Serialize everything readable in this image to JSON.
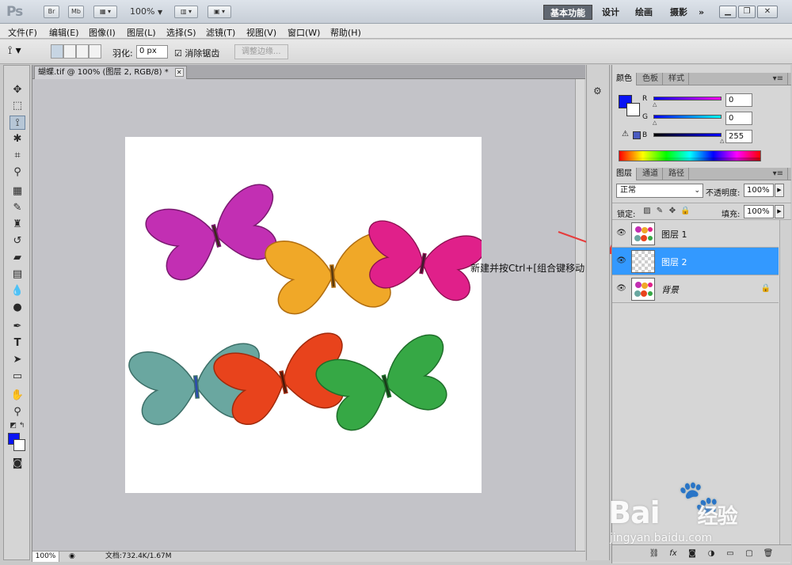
{
  "titlebar": {
    "logo": "Ps",
    "bridge": "Br",
    "minibridge": "Mb",
    "zoom": "100%",
    "workspaces": [
      "基本功能",
      "设计",
      "绘画",
      "摄影"
    ],
    "more": "»"
  },
  "menu": [
    "文件(F)",
    "编辑(E)",
    "图像(I)",
    "图层(L)",
    "选择(S)",
    "滤镜(T)",
    "视图(V)",
    "窗口(W)",
    "帮助(H)"
  ],
  "options": {
    "feather_label": "羽化:",
    "feather_value": "0 px",
    "antialias_label": "消除锯齿",
    "refine_edge": "调整边缘..."
  },
  "document": {
    "tab_title": "蝴蝶.tif @ 100% (图层 2, RGB/8) *",
    "zoom": "100%",
    "doc_info": "文档:732.4K/1.67M"
  },
  "annotation": "新建并按Ctrl+[组合键移动",
  "color_panel": {
    "tabs": [
      "颜色",
      "色板",
      "样式"
    ],
    "channels": [
      {
        "label": "R",
        "value": "0"
      },
      {
        "label": "G",
        "value": "0"
      },
      {
        "label": "B",
        "value": "255"
      }
    ],
    "foreground": "#0a14f5"
  },
  "layers_panel": {
    "tabs": [
      "图层",
      "通道",
      "路径"
    ],
    "blend_mode": "正常",
    "opacity_label": "不透明度:",
    "opacity": "100%",
    "lock_label": "锁定:",
    "fill_label": "填充:",
    "fill": "100%",
    "layers": [
      {
        "name": "图层 1",
        "selected": false
      },
      {
        "name": "图层 2",
        "selected": true
      },
      {
        "name": "背景",
        "selected": false
      }
    ]
  },
  "watermark": {
    "brand": "Bai",
    "brand2": "经验",
    "url": "jingyan.baidu.com"
  },
  "colors": {
    "selection": "#3399ff",
    "annotation_arrow": "#e63b3b"
  }
}
